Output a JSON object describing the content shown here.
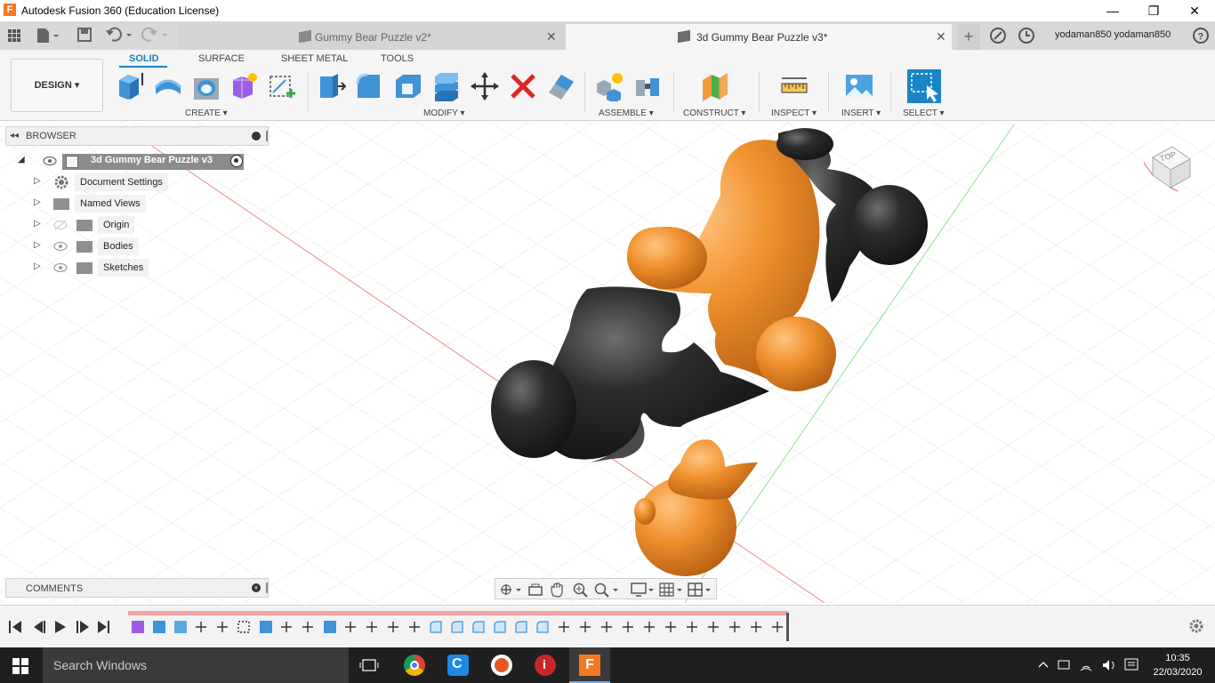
{
  "window": {
    "title": "Autodesk Fusion 360 (Education License)",
    "app_icon_letter": "F",
    "minimize": "—",
    "maximize": "❐",
    "close": "✕"
  },
  "tabs": [
    {
      "label": "Gummy Bear Puzzle v2*",
      "active": false
    },
    {
      "label": "3d Gummy Bear Puzzle v3*",
      "active": true
    }
  ],
  "user": {
    "name": "yodaman850 yodaman850"
  },
  "ribbon": {
    "workspace": "DESIGN",
    "tabs": [
      "SOLID",
      "SURFACE",
      "SHEET METAL",
      "TOOLS"
    ],
    "groups": [
      "CREATE",
      "MODIFY",
      "ASSEMBLE",
      "CONSTRUCT",
      "INSPECT",
      "INSERT",
      "SELECT"
    ]
  },
  "browser": {
    "header": "BROWSER",
    "root": "3d Gummy Bear Puzzle v3",
    "items": [
      "Document Settings",
      "Named Views",
      "Origin",
      "Bodies",
      "Sketches"
    ]
  },
  "comments": {
    "header": "COMMENTS"
  },
  "viewcube": {
    "face": "TOP"
  },
  "taskbar": {
    "search_placeholder": "Search Windows",
    "time": "10:35",
    "date": "22/03/2020"
  },
  "colors": {
    "accent": "#1b84c6",
    "orange_body": "#f0922f",
    "black_body": "#2b2b2b",
    "timeline_track": "#f3a3a3"
  }
}
